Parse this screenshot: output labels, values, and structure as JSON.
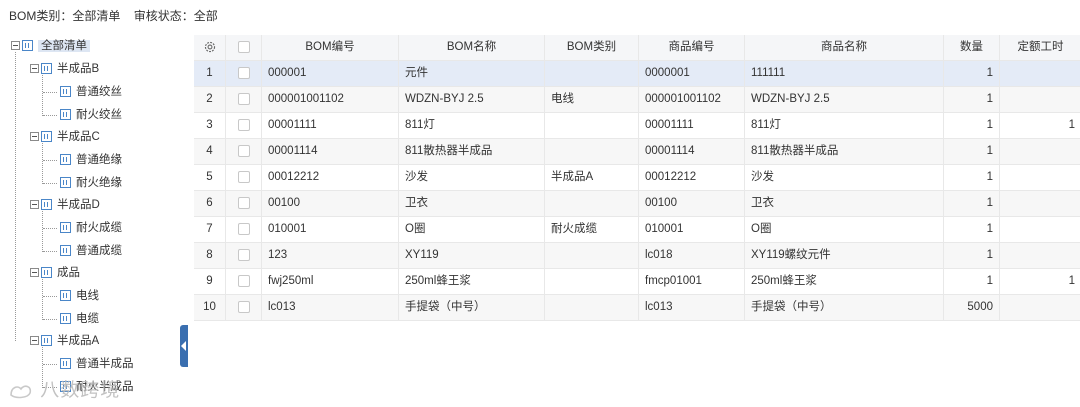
{
  "filter": {
    "bom_type_label": "BOM类别：",
    "bom_type_value": "全部清单",
    "audit_label": "审核状态：",
    "audit_value": "全部"
  },
  "tree": {
    "root": "全部清单",
    "groups": [
      {
        "label": "半成品B",
        "children": [
          "普通绞丝",
          "耐火绞丝"
        ]
      },
      {
        "label": "半成品C",
        "children": [
          "普通绝缘",
          "耐火绝缘"
        ]
      },
      {
        "label": "半成品D",
        "children": [
          "耐火成缆",
          "普通成缆"
        ]
      },
      {
        "label": "成品",
        "children": [
          "电线",
          "电缆"
        ]
      },
      {
        "label": "半成品A",
        "children": [
          "普通半成品",
          "耐火半成品"
        ]
      }
    ]
  },
  "table": {
    "headers": [
      "",
      "",
      "BOM编号",
      "BOM名称",
      "BOM类别",
      "商品编号",
      "商品名称",
      "数量",
      "定额工时"
    ],
    "rows": [
      [
        "1",
        "",
        "000001",
        "元件",
        "",
        "0000001",
        "111111",
        "1",
        ""
      ],
      [
        "2",
        "",
        "000001001102",
        "WDZN-BYJ 2.5",
        "电线",
        "000001001102",
        "WDZN-BYJ 2.5",
        "1",
        ""
      ],
      [
        "3",
        "",
        "00001111",
        "811灯",
        "",
        "00001111",
        "811灯",
        "1",
        "1"
      ],
      [
        "4",
        "",
        "00001114",
        "811散热器半成品",
        "",
        "00001114",
        "811散热器半成品",
        "1",
        ""
      ],
      [
        "5",
        "",
        "00012212",
        "沙发",
        "半成品A",
        "00012212",
        "沙发",
        "1",
        ""
      ],
      [
        "6",
        "",
        "00100",
        "卫衣",
        "",
        "00100",
        "卫衣",
        "1",
        ""
      ],
      [
        "7",
        "",
        "010001",
        "O圈",
        "耐火成缆",
        "010001",
        "O圈",
        "1",
        ""
      ],
      [
        "8",
        "",
        "123",
        "XY119",
        "",
        "lc018",
        "XY119螺纹元件",
        "1",
        ""
      ],
      [
        "9",
        "",
        "fwj250ml",
        "250ml蜂王浆",
        "",
        "fmcp01001",
        "250ml蜂王浆",
        "1",
        "1"
      ],
      [
        "10",
        "",
        "lc013",
        "手提袋（中号）",
        "",
        "lc013",
        "手提袋（中号）",
        "5000",
        ""
      ]
    ]
  },
  "watermark": "八数跨境",
  "colors": {
    "accent": "#3a6fb0",
    "selected_row": "#e4ebf7",
    "header_bg": "#f5f6f8"
  }
}
